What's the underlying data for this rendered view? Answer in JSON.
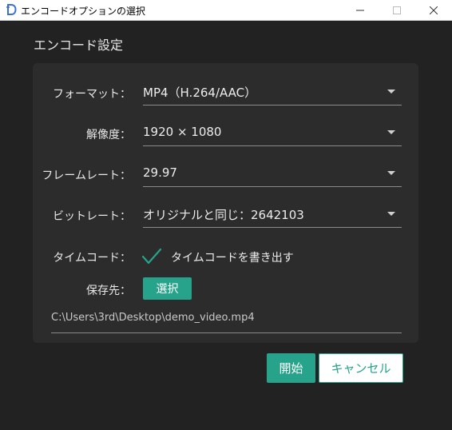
{
  "window": {
    "title": "エンコードオプションの選択",
    "icon": "app-logo-icon",
    "controls": [
      "minimize-icon",
      "maximize-icon",
      "close-icon"
    ]
  },
  "section": {
    "title": "エンコード設定"
  },
  "fields": {
    "format": {
      "label": "フォーマット：",
      "value": "MP4（H.264/AAC）"
    },
    "resolution": {
      "label": "解像度：",
      "value": "1920 × 1080"
    },
    "framerate": {
      "label": "フレームレート：",
      "value": "29.97"
    },
    "bitrate": {
      "label": "ビットレート：",
      "value": "オリジナルと同じ：2642103"
    },
    "timecode": {
      "label": "タイムコード：",
      "checkbox_label": "タイムコードを書き出す",
      "checked": true
    },
    "save_to": {
      "label": "保存先：",
      "button_label": "選択",
      "path": "C:\\Users\\3rd\\Desktop\\demo_video.mp4"
    }
  },
  "actions": {
    "start_label": "開始",
    "cancel_label": "キャンセル"
  },
  "colors": {
    "accent": "#26a38a",
    "background": "#222222",
    "panel": "#2c2c2c"
  }
}
